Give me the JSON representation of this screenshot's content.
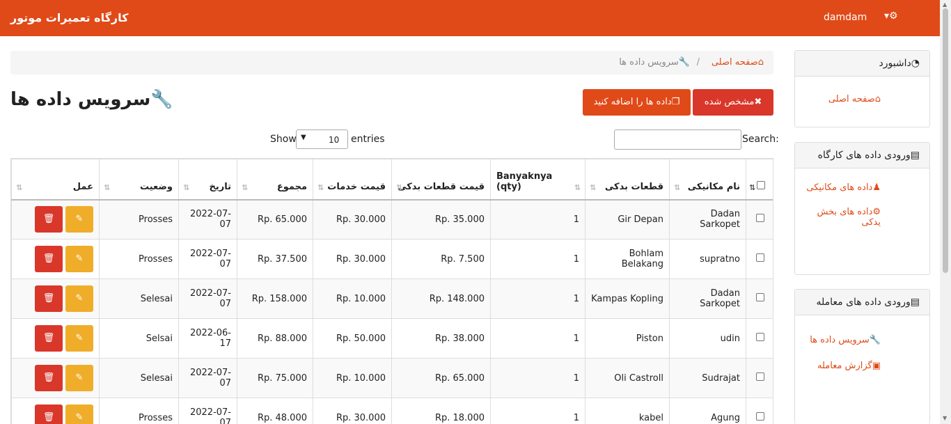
{
  "header": {
    "brand": "کارگاه تعمیرات موتور",
    "user": "damdam",
    "settings_icon": "gear-icon"
  },
  "breadcrumb": {
    "home": "صفحه اصلی",
    "separator": "/",
    "current": "سرویس داده ها"
  },
  "page": {
    "title": "سرویس داده ها",
    "clear_button": "مشخص شده",
    "add_button": "داده ها را اضافه کنید"
  },
  "table_controls": {
    "show_label": "Show",
    "entries_value": "10",
    "entries_label": "entries",
    "search_label": "Search:"
  },
  "table": {
    "columns": [
      "نام مکانیکی",
      "قطعات بدکی",
      "Banyaknya (qty)",
      "قیمت قطعات بدکی",
      "قیمت خدمات",
      "مجموع",
      "تاریخ",
      "وضعیت",
      "عمل"
    ],
    "rows": [
      {
        "mechanic": "Dadan Sarkopet",
        "part": "Gir Depan",
        "qty": "1",
        "part_price": "Rp. 35.000",
        "service_price": "Rp. 30.000",
        "total": "Rp. 65.000",
        "date": "2022-07-07",
        "status": "Prosses"
      },
      {
        "mechanic": "supratno",
        "part": "Bohlam Belakang",
        "qty": "1",
        "part_price": "Rp. 7.500",
        "service_price": "Rp. 30.000",
        "total": "Rp. 37.500",
        "date": "2022-07-07",
        "status": "Prosses"
      },
      {
        "mechanic": "Dadan Sarkopet",
        "part": "Kampas Kopling",
        "qty": "1",
        "part_price": "Rp. 148.000",
        "service_price": "Rp. 10.000",
        "total": "Rp. 158.000",
        "date": "2022-07-07",
        "status": "Selesai"
      },
      {
        "mechanic": "udin",
        "part": "Piston",
        "qty": "1",
        "part_price": "Rp. 38.000",
        "service_price": "Rp. 50.000",
        "total": "Rp. 88.000",
        "date": "2022-06-17",
        "status": "Selsai"
      },
      {
        "mechanic": "Sudrajat",
        "part": "Oli Castroll",
        "qty": "1",
        "part_price": "Rp. 65.000",
        "service_price": "Rp. 10.000",
        "total": "Rp. 75.000",
        "date": "2022-07-07",
        "status": "Selesai"
      },
      {
        "mechanic": "Agung",
        "part": "kabel",
        "qty": "1",
        "part_price": "Rp. 18.000",
        "service_price": "Rp. 30.000",
        "total": "Rp. 48.000",
        "date": "2022-07-07",
        "status": "Prosses"
      }
    ]
  },
  "sidebar": {
    "dashboard": {
      "title": "داشبورد",
      "links": [
        "صفحه اصلی"
      ]
    },
    "workshop": {
      "title": "ورودی داده های کارگاه",
      "links": [
        "داده های مکانیکی",
        "داده های بخش یدکی"
      ]
    },
    "transactions": {
      "title": "ورودی داده های معامله",
      "links": [
        "سرویس داده ها",
        "گزارش معامله"
      ]
    }
  }
}
